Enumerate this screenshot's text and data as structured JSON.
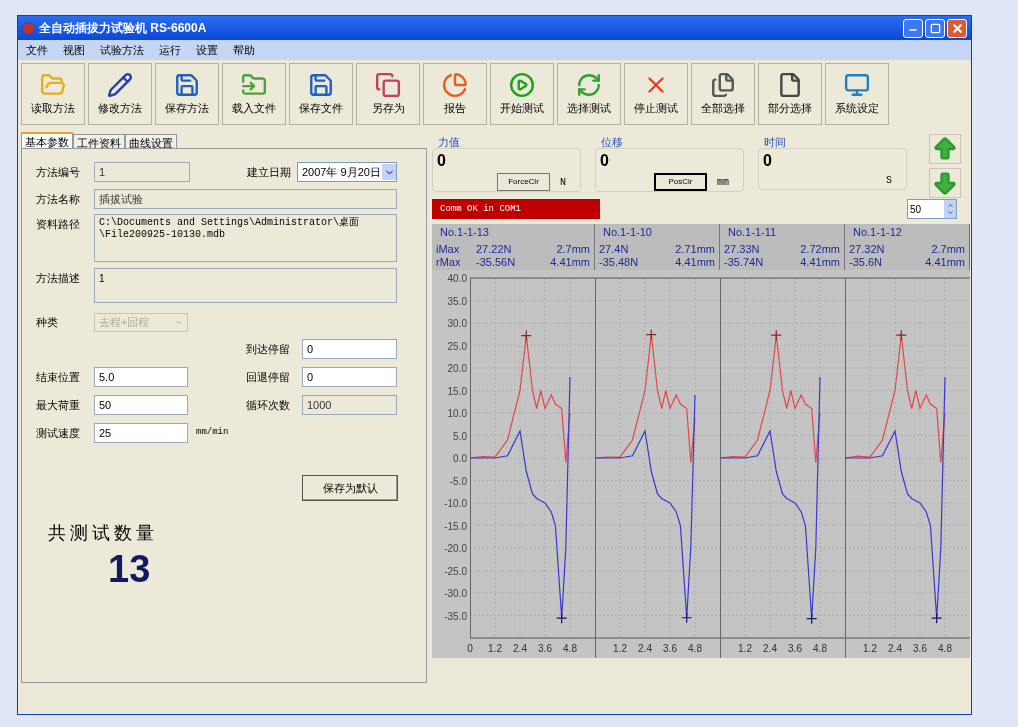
{
  "window": {
    "title": "全自动插拔力试验机 RS-6600A"
  },
  "menu": [
    "文件",
    "视图",
    "试验方法",
    "运行",
    "设置",
    "帮助"
  ],
  "toolbar": [
    {
      "label": "读取方法",
      "kind": "open"
    },
    {
      "label": "修改方法",
      "kind": "edit"
    },
    {
      "label": "保存方法",
      "kind": "save"
    },
    {
      "label": "载入文件",
      "kind": "load"
    },
    {
      "label": "保存文件",
      "kind": "save"
    },
    {
      "label": "另存为",
      "kind": "saveas"
    },
    {
      "label": "报告",
      "kind": "report"
    },
    {
      "label": "开始测试",
      "kind": "start"
    },
    {
      "label": "选择测试",
      "kind": "select"
    },
    {
      "label": "停止测试",
      "kind": "stop"
    },
    {
      "label": "全部选择",
      "kind": "all"
    },
    {
      "label": "部分选择",
      "kind": "part"
    },
    {
      "label": "系统设定",
      "kind": "system"
    }
  ],
  "tabs": [
    {
      "label": "基本参数",
      "selected": true
    },
    {
      "label": "工件资料",
      "selected": false
    },
    {
      "label": "曲线设置",
      "selected": false
    }
  ],
  "form": {
    "method_no": {
      "label": "方法编号",
      "value": "1"
    },
    "date": {
      "label": "建立日期",
      "value": "2007年 9月20日"
    },
    "method_name": {
      "label": "方法名称",
      "value": "插拔试验"
    },
    "data_path": {
      "label": "资料路径",
      "lines": [
        "C:\\Documents and Settings\\Administrator\\桌面",
        "\\File200925-10130.mdb"
      ]
    },
    "description": {
      "label": "方法描述",
      "value": "1"
    },
    "type": {
      "label": "种类",
      "value": "去程+回程",
      "disabled": true
    },
    "left_params": [
      {
        "label": "结束位置",
        "value": "5.0",
        "readonly": false
      },
      {
        "label": "最大荷重",
        "value": "50",
        "readonly": false
      },
      {
        "label": "测试速度",
        "value": "25",
        "readonly": false,
        "unit": "mm/min"
      }
    ],
    "right_params": [
      {
        "label": "到达停留",
        "value": "0",
        "readonly": false
      },
      {
        "label": "回退停留",
        "value": "0",
        "readonly": false
      },
      {
        "label": "循环次数",
        "value": "1000",
        "readonly": true
      }
    ],
    "save_default": "保存为默认"
  },
  "total": {
    "label": "共测试数量",
    "count": "13"
  },
  "readouts": [
    {
      "label": "力值",
      "value": "0",
      "button": "ForceClr",
      "focused": false,
      "unit": "N"
    },
    {
      "label": "位移",
      "value": "0",
      "button": "PosClr",
      "focused": true,
      "unit": "mm"
    },
    {
      "label": "时间",
      "value": "0",
      "unit": "S"
    }
  ],
  "status": "Comm OK in COM1",
  "spinner": "50",
  "graph": {
    "row_labels": [
      "iMax",
      "rMax"
    ],
    "panels": [
      {
        "name": "No.1-1-13",
        "imax": [
          "27.22N",
          "2.7mm"
        ],
        "rmax": [
          "-35.56N",
          "4.41mm"
        ],
        "chart_data": {
          "type": "line",
          "grid": true,
          "xlim": [
            0,
            6
          ],
          "ylim": [
            -40,
            40
          ],
          "yticks": [
            {
              "value": 40,
              "label": "40.0"
            },
            {
              "value": 35,
              "label": "35.0"
            },
            {
              "value": 30,
              "label": "30.0"
            },
            {
              "value": 25,
              "label": "25.0"
            },
            {
              "value": 20,
              "label": "20.0"
            },
            {
              "value": 15,
              "label": "15.0"
            },
            {
              "value": 10,
              "label": "10.0"
            },
            {
              "value": 5,
              "label": "5.0"
            },
            {
              "value": 0,
              "label": "0.0"
            },
            {
              "value": -5,
              "label": "-5.0"
            },
            {
              "value": -10,
              "label": "-10.0"
            },
            {
              "value": -15,
              "label": "-15.0"
            },
            {
              "value": -20,
              "label": "-20.0"
            },
            {
              "value": -25,
              "label": "-25.0"
            },
            {
              "value": -30,
              "label": "-30.0"
            },
            {
              "value": -35,
              "label": "-35.0"
            }
          ],
          "xticks": [
            0,
            1.2,
            2.4,
            3.6,
            4.8
          ],
          "x": [
            0,
            0.6,
            1.2,
            1.8,
            2.4,
            2.7,
            3.0,
            3.2,
            3.4,
            3.6,
            3.9,
            4.1,
            4.4,
            4.6,
            4.8
          ],
          "series": [
            {
              "color": "#e04848",
              "values": [
                0,
                0.3,
                0.2,
                4,
                15,
                27.2,
                15,
                11,
                15,
                11,
                14,
                12,
                11,
                -1,
                10
              ]
            },
            {
              "color": "#3838d0",
              "values": [
                0,
                0,
                0,
                0.5,
                6,
                -3,
                -8,
                -9,
                -9.5,
                -10,
                -12,
                -15,
                -35.6,
                -20,
                18
              ]
            }
          ]
        }
      },
      {
        "name": "No.1-1-10",
        "imax": [
          "27.4N",
          "2.71mm"
        ],
        "rmax": [
          "-35.48N",
          "4.41mm"
        ],
        "chart_data": {
          "type": "line",
          "grid": true,
          "xlim": [
            0,
            6
          ],
          "ylim": [
            -40,
            40
          ],
          "xticks": [
            1.2,
            2.4,
            3.6,
            4.8
          ],
          "x": [
            0,
            0.6,
            1.2,
            1.8,
            2.4,
            2.7,
            3.0,
            3.2,
            3.4,
            3.6,
            3.9,
            4.1,
            4.4,
            4.6,
            4.8
          ],
          "series": [
            {
              "color": "#e04848",
              "values": [
                0,
                0.2,
                0.2,
                4,
                15,
                27.4,
                15,
                11,
                15,
                11,
                14,
                12,
                11,
                -1,
                9
              ]
            },
            {
              "color": "#3838d0",
              "values": [
                0,
                0,
                0,
                0.5,
                6,
                -3,
                -8,
                -9,
                -9.5,
                -10,
                -12,
                -15,
                -35.5,
                -20,
                14
              ]
            }
          ]
        }
      },
      {
        "name": "No.1-1-11",
        "imax": [
          "27.33N",
          "2.72mm"
        ],
        "rmax": [
          "-35.74N",
          "4.41mm"
        ],
        "chart_data": {
          "type": "line",
          "grid": true,
          "xlim": [
            0,
            6
          ],
          "ylim": [
            -40,
            40
          ],
          "xticks": [
            1.2,
            2.4,
            3.6,
            4.8
          ],
          "x": [
            0,
            0.6,
            1.2,
            1.8,
            2.4,
            2.7,
            3.0,
            3.2,
            3.4,
            3.6,
            3.9,
            4.1,
            4.4,
            4.6,
            4.8
          ],
          "series": [
            {
              "color": "#e04848",
              "values": [
                0,
                0.3,
                0.2,
                4,
                15,
                27.3,
                15,
                11,
                15,
                11,
                14,
                12,
                11,
                -1,
                10
              ]
            },
            {
              "color": "#3838d0",
              "values": [
                0,
                0,
                0,
                0.5,
                6,
                -3,
                -8,
                -9,
                -9.5,
                -10,
                -12,
                -15,
                -35.7,
                -20,
                18
              ]
            }
          ]
        }
      },
      {
        "name": "No.1-1-12",
        "imax": [
          "27.32N",
          "2.7mm"
        ],
        "rmax": [
          "-35.6N",
          "4.41mm"
        ],
        "chart_data": {
          "type": "line",
          "grid": true,
          "xlim": [
            0,
            6
          ],
          "ylim": [
            -40,
            40
          ],
          "xticks": [
            1.2,
            2.4,
            3.6,
            4.8
          ],
          "x": [
            0,
            0.6,
            1.2,
            1.8,
            2.4,
            2.7,
            3.0,
            3.2,
            3.4,
            3.6,
            3.9,
            4.1,
            4.4,
            4.6,
            4.8
          ],
          "series": [
            {
              "color": "#e04848",
              "values": [
                0,
                0.4,
                0.2,
                4,
                15,
                27.3,
                15,
                11,
                15,
                11,
                14,
                12,
                11,
                -1,
                10
              ]
            },
            {
              "color": "#3838d0",
              "values": [
                0,
                0,
                0,
                0.5,
                6,
                -3,
                -8,
                -9,
                -9.5,
                -10,
                -12,
                -15,
                -35.6,
                -20,
                18
              ]
            }
          ]
        }
      }
    ]
  }
}
